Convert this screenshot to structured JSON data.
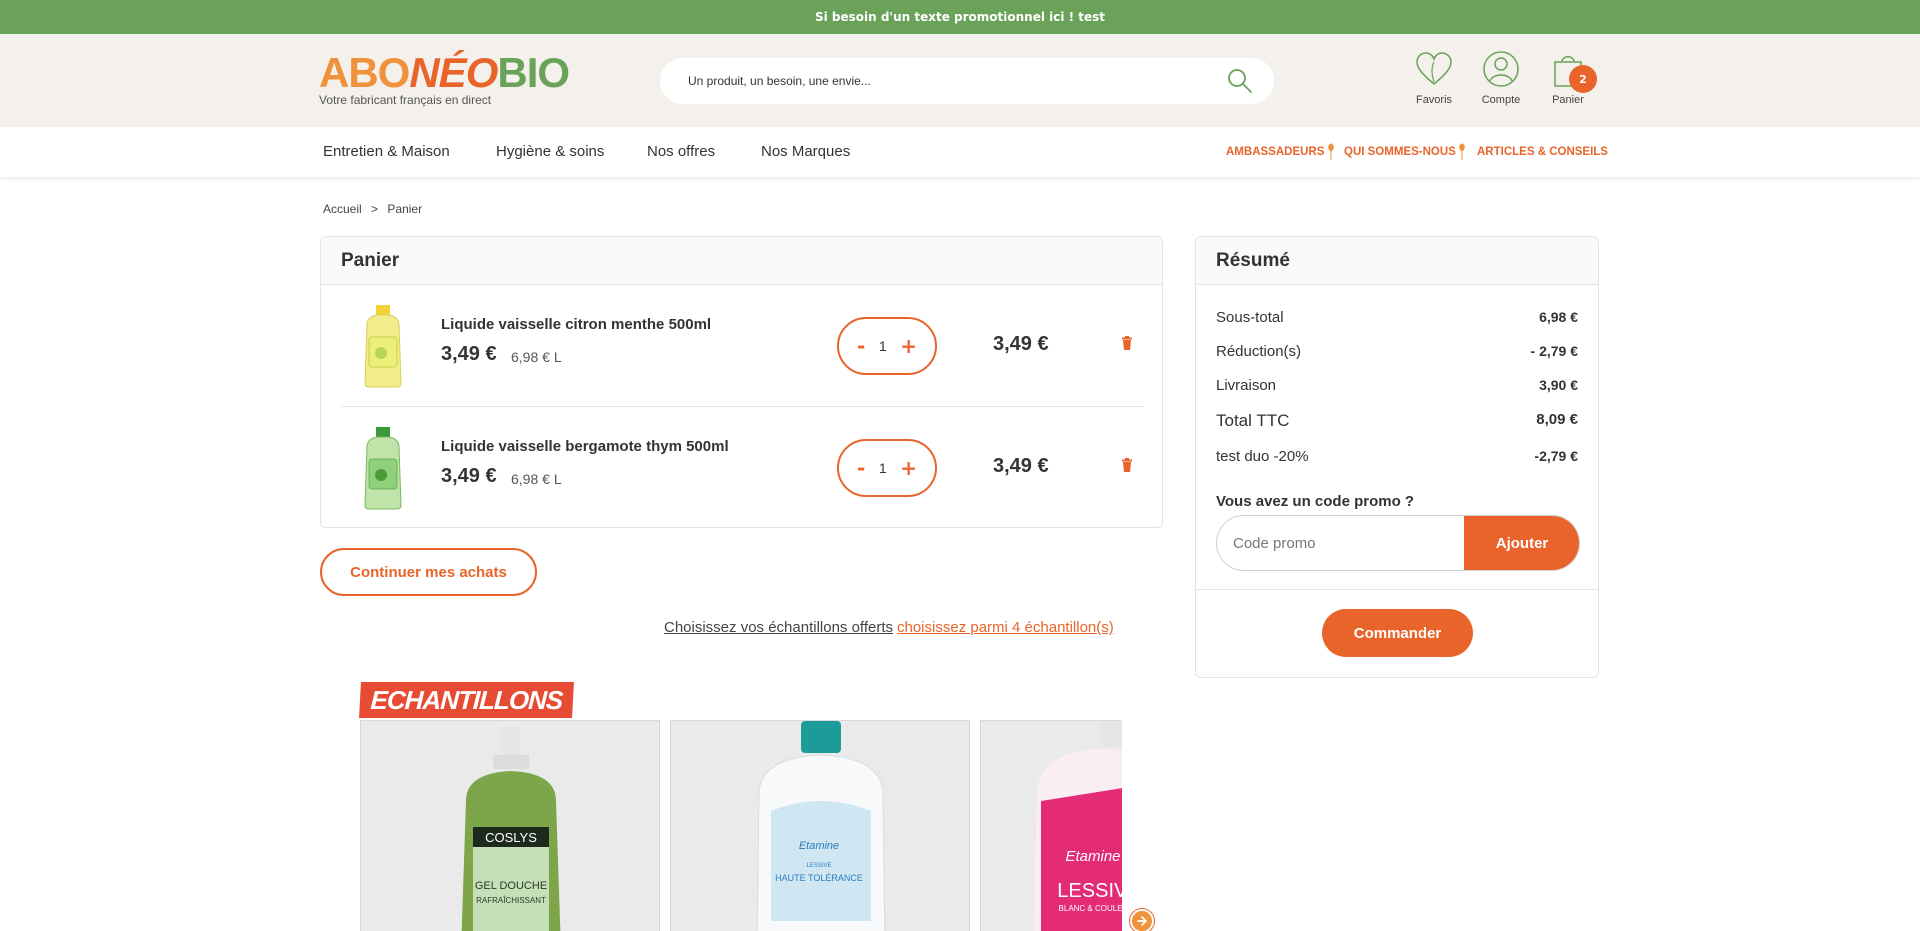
{
  "promo_bar": {
    "text": "Si besoin d'un texte promotionnel ici ! test"
  },
  "brand": {
    "logo_abo": "ABO",
    "logo_neo": "NÉO",
    "logo_bio": "BIO",
    "tagline": "Votre fabricant français en direct",
    "colors": {
      "orange": "#e8642a",
      "light_orange": "#f0913b",
      "green": "#6aa25a",
      "header_bg": "#f4f1ec"
    }
  },
  "search": {
    "placeholder": "Un produit, un besoin, une envie...",
    "icon": "search-icon"
  },
  "header_icons": [
    {
      "label": "Favoris",
      "icon": "heart-icon"
    },
    {
      "label": "Compte",
      "icon": "user-icon"
    },
    {
      "label": "Panier",
      "icon": "shopping-bag-icon",
      "badge": "2"
    }
  ],
  "nav": {
    "main": [
      "Entretien & Maison",
      "Hygiène & soins",
      "Nos offres",
      "Nos Marques"
    ],
    "secondary": [
      "AMBASSADEURS",
      "QUI SOMMES-NOUS",
      "ARTICLES & CONSEILS"
    ]
  },
  "breadcrumb": [
    "Accueil",
    ">",
    "Panier"
  ],
  "cart": {
    "title": "Panier",
    "items": [
      {
        "name": "Liquide vaisselle citron menthe 500ml",
        "price": "3,49 €",
        "unit_price": "6,98 € L",
        "quantity": "1",
        "total": "3,49 €",
        "minus": "-",
        "plus": "+",
        "image_tint": "#f3ec8a"
      },
      {
        "name": "Liquide vaisselle bergamote thym 500ml",
        "price": "3,49 €",
        "unit_price": "6,98 € L",
        "quantity": "1",
        "total": "3,49 €",
        "minus": "-",
        "plus": "+",
        "image_tint": "#8fd07a"
      }
    ],
    "continue_label": "Continuer mes achats"
  },
  "samples": {
    "text": "Choisissez vos échantillons offerts",
    "link": "choisissez parmi 4 échantillon(s)",
    "banner": "ECHANTILLONS",
    "products": [
      {
        "brand": "COSLYS",
        "name": "GEL DOUCHE",
        "sub": "RAFRAÎCHISSANT"
      },
      {
        "brand": "Etamine",
        "name": "HAUTE TOLÉRANCE",
        "sub": "LESSIVE"
      },
      {
        "brand": "Etamine",
        "name": "LESSIVE",
        "sub": "BLANC & COULEURS"
      }
    ]
  },
  "summary": {
    "title": "Résumé",
    "rows": [
      {
        "label": "Sous-total",
        "value": "6,98 €"
      },
      {
        "label": "Réduction(s)",
        "value": "- 2,79 €"
      },
      {
        "label": "Livraison",
        "value": "3,90 €"
      },
      {
        "label": "Total TTC",
        "value": "8,09 €"
      },
      {
        "label": "test duo -20%",
        "value": "-2,79 €"
      }
    ],
    "promo_question": "Vous avez un code promo ?",
    "promo_placeholder": "Code promo",
    "promo_button": "Ajouter",
    "order_button": "Commander"
  }
}
